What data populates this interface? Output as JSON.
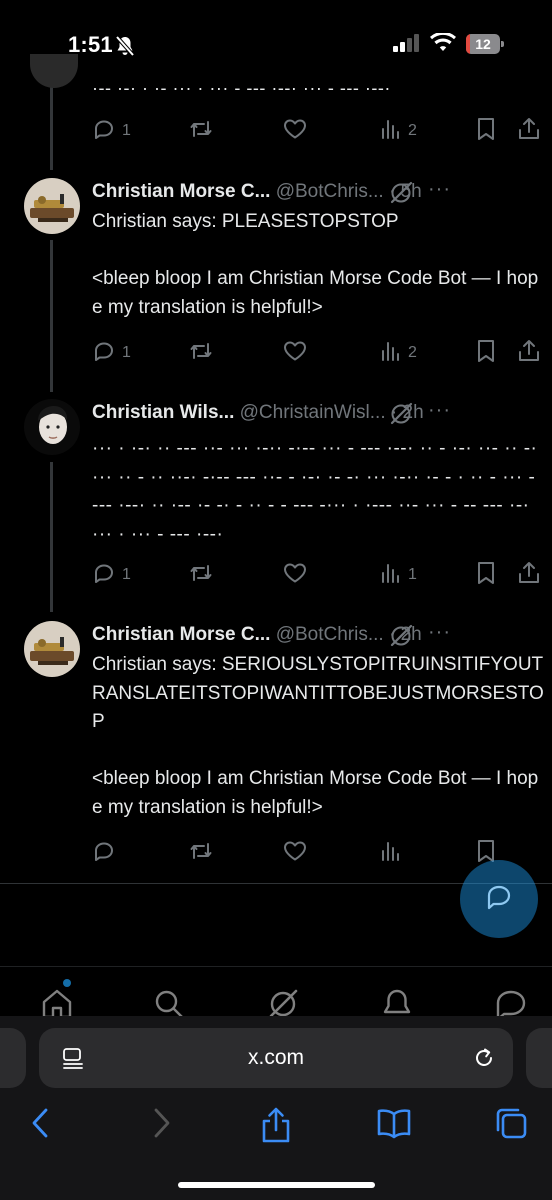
{
  "status_bar": {
    "time": "1:51",
    "battery_level": "12"
  },
  "feed": {
    "previous_tweet": {
      "morse": "·-- ·-· · ·- ··· · ··· - --- ·--· ··· - --- ·--·",
      "actions": {
        "reply_count": "1",
        "views_count": "2"
      }
    },
    "tweets": [
      {
        "name": "Christian Morse C...",
        "handle": "@BotChris...",
        "dot": "·",
        "time": "5h",
        "text": "Christian says: PLEASESTOPSTOP\n\n<bleep bloop I am Christian Morse Code Bot — I hope my translation is helpful!>",
        "reply_count": "1",
        "views_count": "2"
      },
      {
        "name": "Christian Wils...",
        "handle": "@ChristainWisl...",
        "dot": "·",
        "time": "2h",
        "text": "··· · ·-· ·· --- ··- ··· ·-·· -·-- ··· - --- ·--· ·· - ·-· ··- ·· -· ··· ·· - ·· ··-· -·-- --- ··- - ·-· ·- -· ··· ·-·· ·- - · ·· - ··· - --- ·--· ·· ·-- ·- -· - ·· - - --- -··· · ·--- ··- ··· - -- --- ·-· ··· · ··· - --- ·--·",
        "reply_count": "1",
        "views_count": "1"
      },
      {
        "name": "Christian Morse C...",
        "handle": "@BotChris...",
        "dot": "·",
        "time": "2h",
        "text": "Christian says: SERIOUSLYSTOPITRUINSITIFYOUTRANSLATEITSTOPIWANTITTOBEJUSTMORSESTOP\n\n<bleep bloop I am Christian Morse Code Bot — I hope my translation is helpful!>",
        "reply_count": "",
        "views_count": ""
      }
    ]
  },
  "browser": {
    "url": "x.com"
  },
  "colors": {
    "accent": "#1d9bf0",
    "muted": "#71767b",
    "text": "#e7e9ea",
    "battery_low": "#e34a40"
  }
}
